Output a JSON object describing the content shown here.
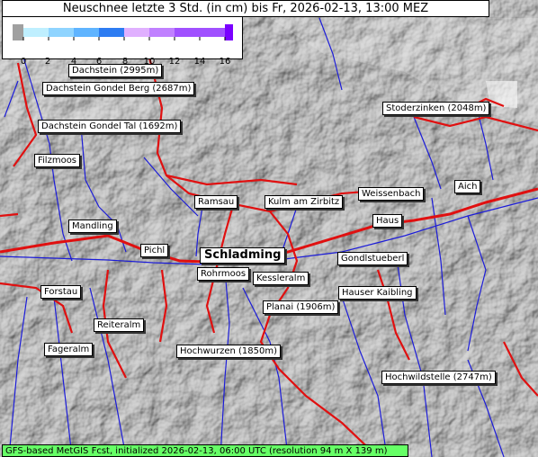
{
  "title": "Neuschnee letzte 3 Std. (in cm) bis Fr, 2026-02-13, 13:00 MEZ",
  "legend": {
    "ticks": [
      "0",
      "2",
      "4",
      "6",
      "8",
      "10",
      "12",
      "14",
      "16"
    ],
    "colors": [
      "#e8e8e8",
      "#bfefff",
      "#8fd4ff",
      "#5fb4ff",
      "#2d7cf2",
      "#e0b0ff",
      "#c080ff",
      "#a050ff",
      "#7a00ff"
    ]
  },
  "places": [
    {
      "id": "dachstein",
      "label": "Dachstein (2995m)"
    },
    {
      "id": "dachstein-gondel-berg",
      "label": "Dachstein Gondel Berg (2687m)"
    },
    {
      "id": "dachstein-gondel-tal",
      "label": "Dachstein Gondel Tal (1692m)"
    },
    {
      "id": "filzmoos",
      "label": "Filzmoos"
    },
    {
      "id": "stoderzinken",
      "label": "Stoderzinken (2048m)"
    },
    {
      "id": "aich",
      "label": "Aich"
    },
    {
      "id": "weissenbach",
      "label": "Weissenbach"
    },
    {
      "id": "ramsau",
      "label": "Ramsau"
    },
    {
      "id": "kulm-am-zirbitz",
      "label": "Kulm am Zirbitz"
    },
    {
      "id": "haus",
      "label": "Haus"
    },
    {
      "id": "mandling",
      "label": "Mandling"
    },
    {
      "id": "pichl",
      "label": "Pichl"
    },
    {
      "id": "schladming",
      "label": "Schladming"
    },
    {
      "id": "gondlstueberl",
      "label": "Gondlstueberl"
    },
    {
      "id": "rohrmoos",
      "label": "Rohrmoos"
    },
    {
      "id": "forstau",
      "label": "Forstau"
    },
    {
      "id": "kesslerlalm",
      "label": "Kessleralm"
    },
    {
      "id": "hauser-kaibling",
      "label": "Hauser Kaibling"
    },
    {
      "id": "planai",
      "label": "Planai (1906m)"
    },
    {
      "id": "reiteralm",
      "label": "Reiteralm"
    },
    {
      "id": "fageralm",
      "label": "Fageralm"
    },
    {
      "id": "hochwurzen",
      "label": "Hochwurzen (1850m)"
    },
    {
      "id": "hochwildstelle",
      "label": "Hochwildstelle (2747m)"
    }
  ],
  "footer": "GFS-based MetGIS Fcst, initialized 2026-02-13, 06:00 UTC  (resolution 94 m X 139 m)"
}
